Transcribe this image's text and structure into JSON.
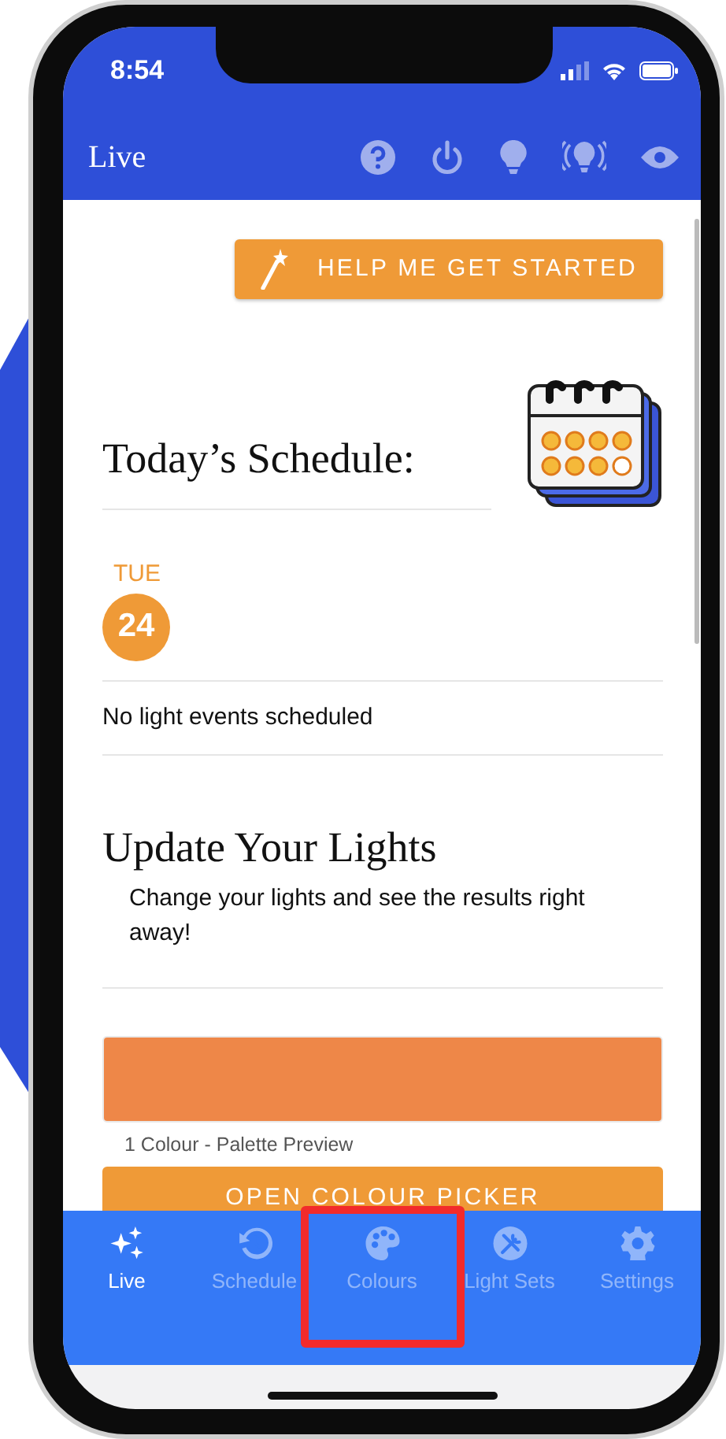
{
  "status_bar": {
    "time": "8:54"
  },
  "header": {
    "title": "Live"
  },
  "help_button": {
    "label": "HELP ME GET STARTED"
  },
  "schedule": {
    "title": "Today’s Schedule:",
    "day": "TUE",
    "date": "24",
    "empty_message": "No light events scheduled"
  },
  "update": {
    "title": "Update Your Lights",
    "description": "Change your lights and see the results right away!",
    "palette": {
      "colors": [
        {
          "color": "#ee8748"
        }
      ],
      "caption": "1 Colour - Palette Preview"
    },
    "button": "OPEN COLOUR PICKER"
  },
  "tabs": [
    {
      "label": "Live",
      "selected": true,
      "highlighted": false
    },
    {
      "label": "Schedule",
      "selected": false,
      "highlighted": false
    },
    {
      "label": "Colours",
      "selected": false,
      "highlighted": true
    },
    {
      "label": "Light Sets",
      "selected": false,
      "highlighted": false
    },
    {
      "label": "Settings",
      "selected": false,
      "highlighted": false
    }
  ]
}
